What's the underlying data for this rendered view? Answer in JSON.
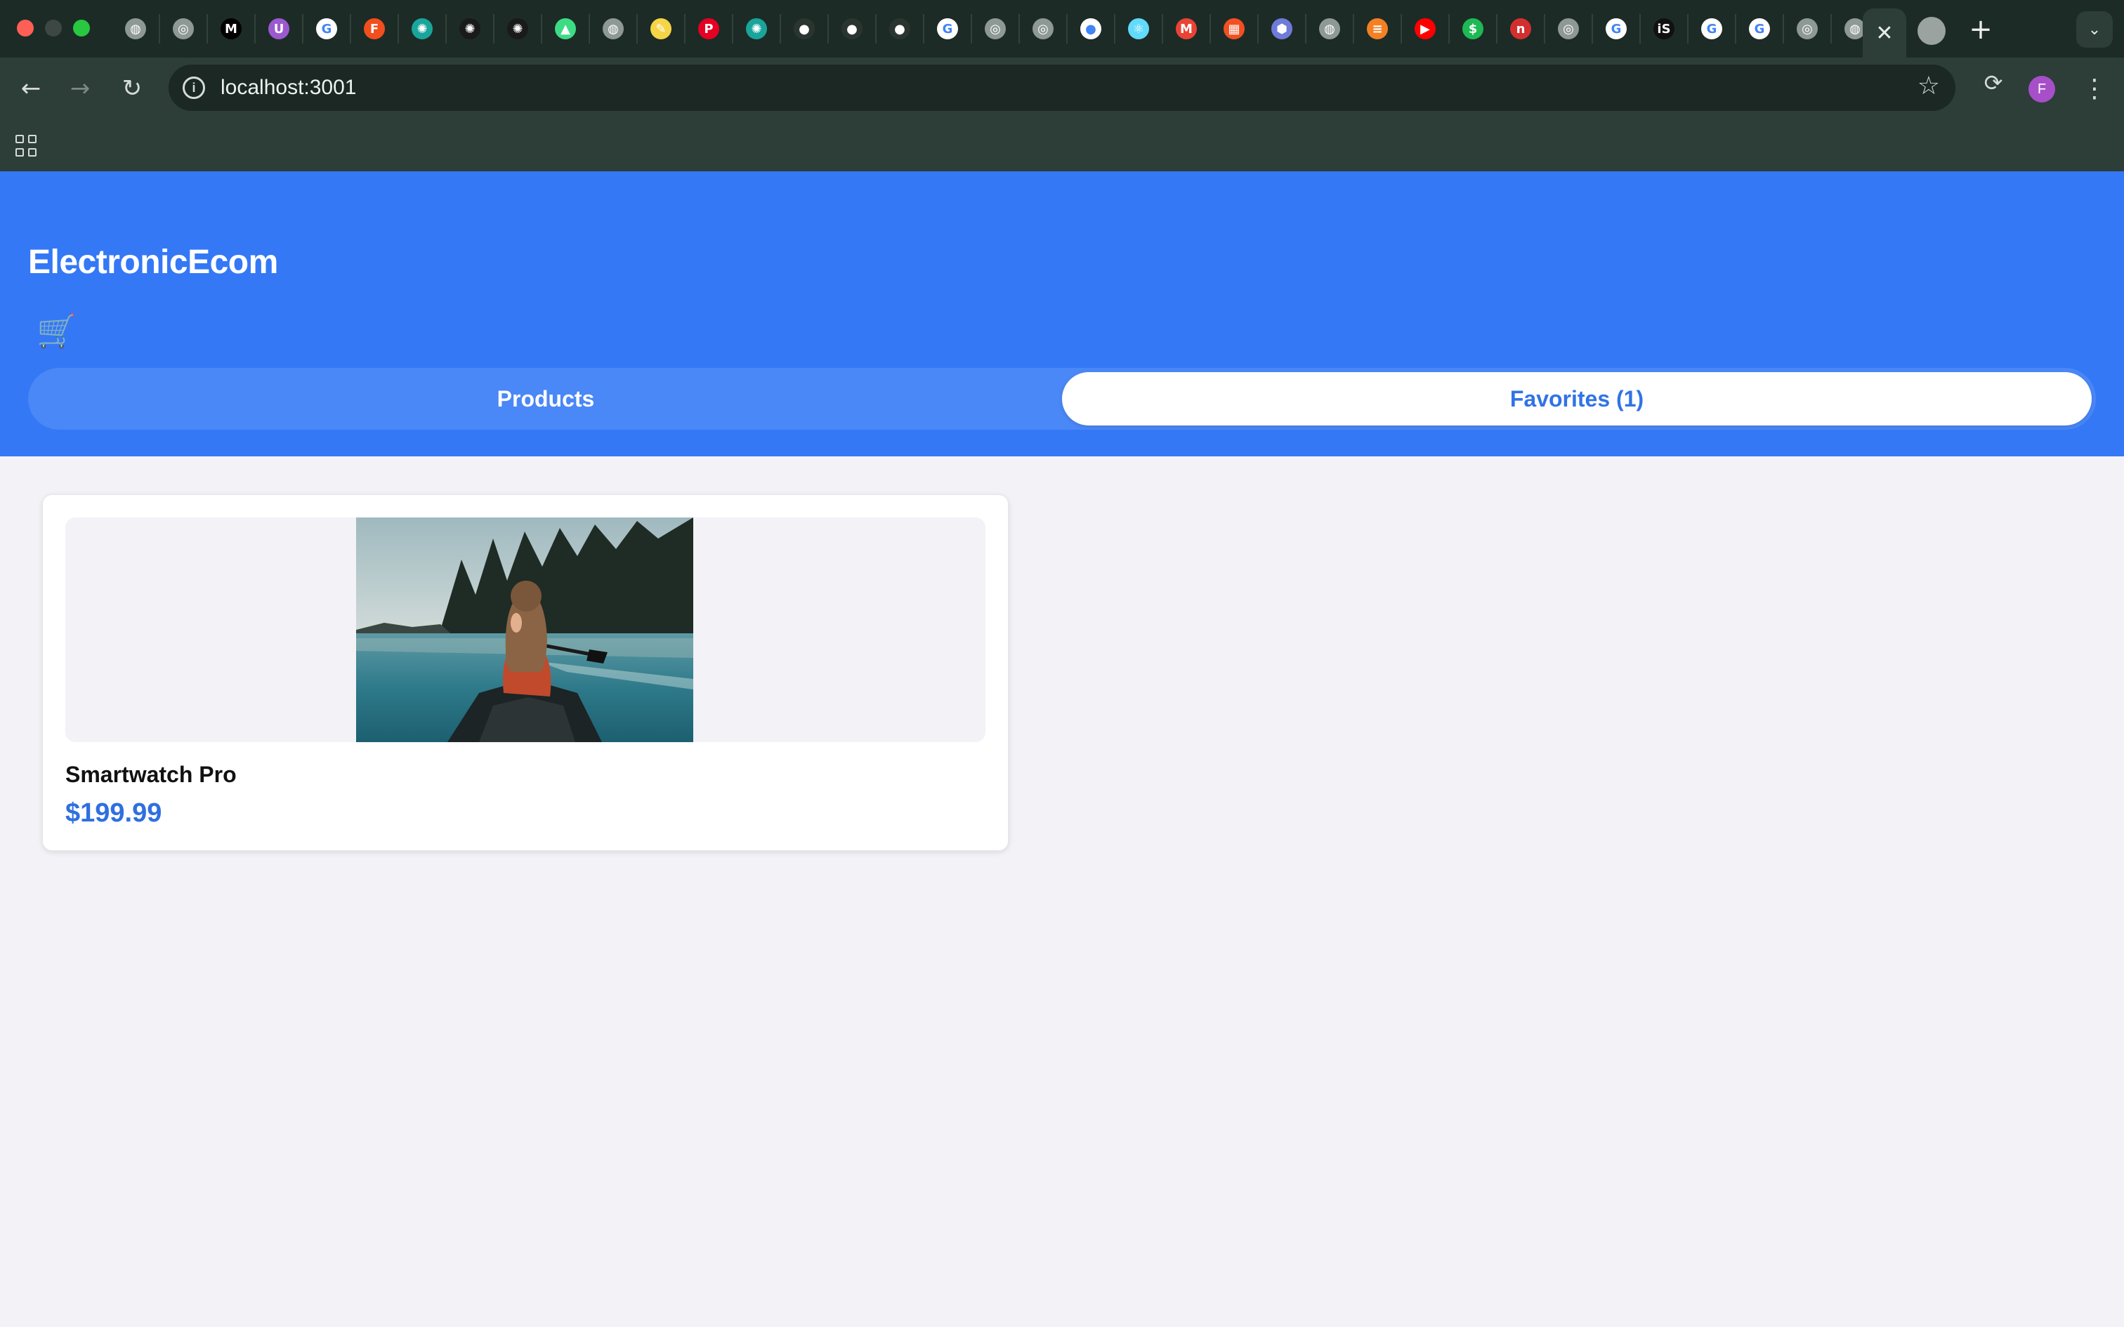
{
  "browser": {
    "url": "localhost:3001",
    "profile_initial": "F",
    "active_tab_close": "✕",
    "new_tab_label": "+",
    "tab_favicons": [
      {
        "icon": "globe-icon",
        "glyph": "◍",
        "color": "#8e9995"
      },
      {
        "icon": "chrome-icon",
        "glyph": "◎",
        "color": "#8e9995"
      },
      {
        "icon": "medium-icon",
        "glyph": "M",
        "color": "#000000"
      },
      {
        "icon": "upwork-icon",
        "glyph": "U",
        "color": "#9b59d0"
      },
      {
        "icon": "google-icon",
        "glyph": "G",
        "color": "#ffffff"
      },
      {
        "icon": "figma-icon",
        "glyph": "F",
        "color": "#f24e1e"
      },
      {
        "icon": "openai-icon",
        "glyph": "✺",
        "color": "#19a59b"
      },
      {
        "icon": "openai-dark-icon",
        "glyph": "✺",
        "color": "#1a1a1a"
      },
      {
        "icon": "openai-dark-icon",
        "glyph": "✺",
        "color": "#1a1a1a"
      },
      {
        "icon": "android-icon",
        "glyph": "▲",
        "color": "#3ddc84"
      },
      {
        "icon": "globe-icon",
        "glyph": "◍",
        "color": "#8e9995"
      },
      {
        "icon": "notes-icon",
        "glyph": "✎",
        "color": "#f5d547"
      },
      {
        "icon": "pinterest-icon",
        "glyph": "P",
        "color": "#e60023"
      },
      {
        "icon": "openai-icon",
        "glyph": "✺",
        "color": "#19a59b"
      },
      {
        "icon": "github-icon",
        "glyph": "●",
        "color": "#2a3530"
      },
      {
        "icon": "github-icon",
        "glyph": "●",
        "color": "#2a3530"
      },
      {
        "icon": "github-icon",
        "glyph": "●",
        "color": "#2a3530"
      },
      {
        "icon": "google-icon",
        "glyph": "G",
        "color": "#ffffff"
      },
      {
        "icon": "chrome-icon",
        "glyph": "◎",
        "color": "#8e9995"
      },
      {
        "icon": "chrome-icon",
        "glyph": "◎",
        "color": "#8e9995"
      },
      {
        "icon": "github-icon",
        "glyph": "●",
        "color": "#ffffff"
      },
      {
        "icon": "react-icon",
        "glyph": "⚛",
        "color": "#61dafb"
      },
      {
        "icon": "gmail-icon",
        "glyph": "M",
        "color": "#ea4335"
      },
      {
        "icon": "microsoft-icon",
        "glyph": "▦",
        "color": "#f25022"
      },
      {
        "icon": "hexagon-icon",
        "glyph": "⬢",
        "color": "#6f7bd9"
      },
      {
        "icon": "globe-icon",
        "glyph": "◍",
        "color": "#8e9995"
      },
      {
        "icon": "stackoverflow-icon",
        "glyph": "≡",
        "color": "#f48024"
      },
      {
        "icon": "youtube-icon",
        "glyph": "▶",
        "color": "#ff0000"
      },
      {
        "icon": "dollar-icon",
        "glyph": "$",
        "color": "#1db954"
      },
      {
        "icon": "n-icon",
        "glyph": "n",
        "color": "#d32f2f"
      },
      {
        "icon": "chrome-icon",
        "glyph": "◎",
        "color": "#8e9995"
      },
      {
        "icon": "google-icon",
        "glyph": "G",
        "color": "#ffffff"
      },
      {
        "icon": "is-icon",
        "glyph": "iS",
        "color": "#111111"
      },
      {
        "icon": "google-icon",
        "glyph": "G",
        "color": "#ffffff"
      },
      {
        "icon": "google-icon",
        "glyph": "G",
        "color": "#ffffff"
      },
      {
        "icon": "chrome-icon",
        "glyph": "◎",
        "color": "#8e9995"
      },
      {
        "icon": "globe-icon",
        "glyph": "◍",
        "color": "#8e9995"
      }
    ]
  },
  "app": {
    "brand": "ElectronicEcom",
    "cart_icon": "🛒",
    "tabs": [
      {
        "label": "Products",
        "active": false
      },
      {
        "label": "Favorites (1)",
        "active": true
      }
    ],
    "accent_color": "#3478f6"
  },
  "favorites": [
    {
      "name": "Smartwatch Pro",
      "price": "$199.99",
      "image": "woman-in-canoe-on-lake"
    }
  ]
}
